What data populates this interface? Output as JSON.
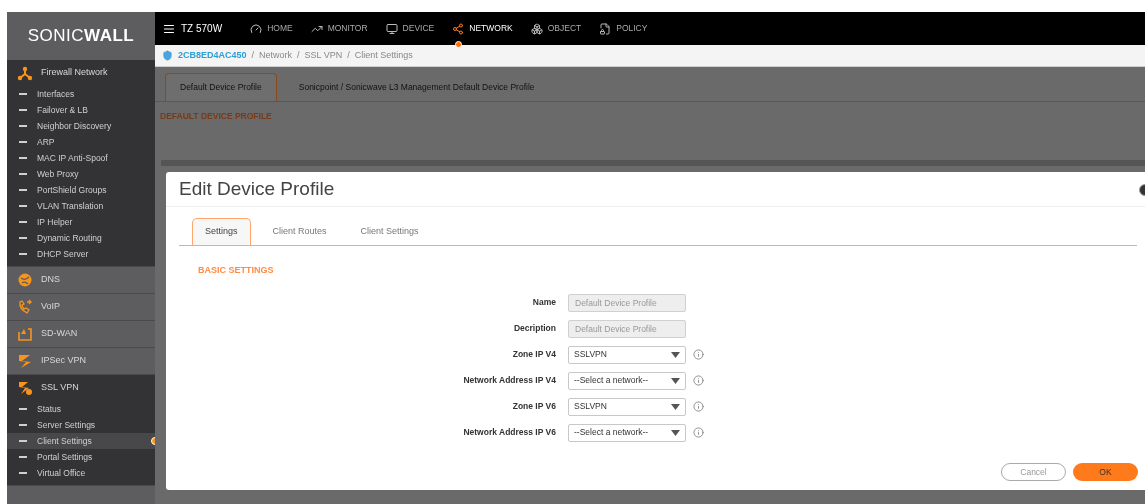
{
  "sidebar": {
    "logo": "SONIC**WALL**",
    "sections": [
      {
        "label": "Firewall Network",
        "expanded": true,
        "children": [
          {
            "label": "Interfaces",
            "selected": false
          },
          {
            "label": "Failover & LB",
            "selected": false
          },
          {
            "label": "Neighbor Discovery",
            "selected": false
          },
          {
            "label": "ARP",
            "selected": false
          },
          {
            "label": "MAC IP Anti-Spoof",
            "selected": false
          },
          {
            "label": "Web Proxy",
            "selected": false
          },
          {
            "label": "PortShield Groups",
            "selected": false
          },
          {
            "label": "VLAN Translation",
            "selected": false
          },
          {
            "label": "IP Helper",
            "selected": false
          },
          {
            "label": "Dynamic Routing",
            "selected": false
          },
          {
            "label": "DHCP Server",
            "selected": false
          }
        ]
      },
      {
        "label": "DNS",
        "expanded": false
      },
      {
        "label": "VoIP",
        "expanded": false
      },
      {
        "label": "SD-WAN",
        "expanded": false
      },
      {
        "label": "IPSec VPN",
        "expanded": false
      },
      {
        "label": "SSL VPN",
        "expanded": true,
        "children": [
          {
            "label": "Status",
            "selected": false
          },
          {
            "label": "Server Settings",
            "selected": false
          },
          {
            "label": "Client Settings",
            "selected": true
          },
          {
            "label": "Portal Settings",
            "selected": false
          },
          {
            "label": "Virtual Office",
            "selected": false
          }
        ]
      }
    ]
  },
  "topbar": {
    "device": "TZ 570W",
    "nav": [
      {
        "label": "HOME",
        "selected": false
      },
      {
        "label": "MONITOR",
        "selected": false
      },
      {
        "label": "DEVICE",
        "selected": false
      },
      {
        "label": "NETWORK",
        "selected": true
      },
      {
        "label": "OBJECT",
        "selected": false
      },
      {
        "label": "POLICY",
        "selected": false
      }
    ]
  },
  "breadcrumb": {
    "device": "2CB8ED4AC450",
    "path": [
      "Network",
      "SSL VPN",
      "Client Settings"
    ],
    "separators": [
      "/",
      "/",
      "/"
    ]
  },
  "page": {
    "tabs": [
      {
        "label": "Default Device Profile",
        "selected": true
      },
      {
        "label": "Sonicpoint / Sonicwave L3 Management Default Device Profile",
        "selected": false
      }
    ],
    "heading": "DEFAULT DEVICE PROFILE"
  },
  "modal": {
    "title": "Edit Device Profile",
    "tabs": [
      {
        "label": "Settings",
        "selected": true
      },
      {
        "label": "Client Routes",
        "selected": false
      },
      {
        "label": "Client Settings",
        "selected": false
      }
    ],
    "section": "BASIC SETTINGS",
    "fields": [
      {
        "label": "Name",
        "kind": "text",
        "value": "Default Device Profile",
        "disabled": true,
        "info": false
      },
      {
        "label": "Decription",
        "kind": "text",
        "value": "Default Device Profile",
        "disabled": true,
        "info": false
      },
      {
        "label": "Zone IP V4",
        "kind": "select",
        "value": "SSLVPN",
        "disabled": false,
        "info": true
      },
      {
        "label": "Network Address IP V4",
        "kind": "select",
        "value": "--Select a network--",
        "disabled": false,
        "info": true
      },
      {
        "label": "Zone IP V6",
        "kind": "select",
        "value": "SSLVPN",
        "disabled": false,
        "info": true
      },
      {
        "label": "Network Address IP V6",
        "kind": "select",
        "value": "--Select a network--",
        "disabled": false,
        "info": true
      }
    ],
    "buttons": [
      {
        "label": "Cancel",
        "kind": "secondary"
      },
      {
        "label": "OK",
        "kind": "primary"
      }
    ]
  }
}
